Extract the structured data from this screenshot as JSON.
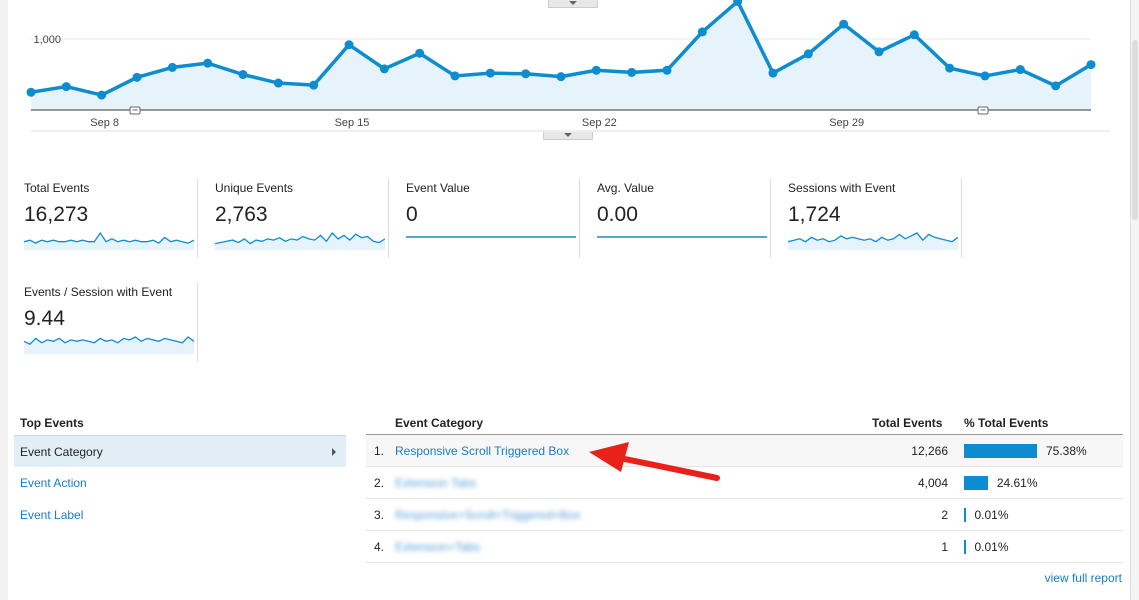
{
  "main_chart": {
    "y_tick_label": "1,000",
    "x_tick_labels": [
      "Sep 8",
      "Sep 15",
      "Sep 22",
      "Sep 29"
    ],
    "colors": {
      "line": "#0e8cd0",
      "fill": "#e6f3fa",
      "grid": "#e8e8e8"
    },
    "y_range": [
      0,
      1550
    ],
    "values": [
      250,
      330,
      210,
      460,
      600,
      660,
      500,
      380,
      350,
      920,
      580,
      800,
      480,
      520,
      510,
      470,
      560,
      530,
      560,
      1100,
      1530,
      520,
      790,
      1210,
      820,
      1060,
      590,
      480,
      570,
      340,
      640
    ],
    "annotation_markers": [
      "annotation-icon",
      "annotation-icon"
    ]
  },
  "metrics": [
    {
      "label": "Total Events",
      "value": "16,273",
      "spark": [
        3,
        4,
        2,
        4,
        3,
        4,
        3,
        3,
        4,
        3,
        4,
        3,
        3,
        9,
        3,
        5,
        3,
        4,
        3,
        4,
        3,
        3,
        4,
        2,
        6,
        3,
        4,
        3,
        2,
        4
      ],
      "flat": false
    },
    {
      "label": "Unique Events",
      "value": "2,763",
      "spark": [
        2,
        3,
        4,
        5,
        3,
        6,
        2,
        5,
        4,
        6,
        5,
        7,
        4,
        6,
        5,
        8,
        6,
        5,
        9,
        4,
        11,
        6,
        9,
        5,
        10,
        7,
        8,
        4,
        3,
        6
      ],
      "flat": false
    },
    {
      "label": "Event Value",
      "value": "0",
      "spark": [],
      "flat": true
    },
    {
      "label": "Avg. Value",
      "value": "0.00",
      "spark": [],
      "flat": true
    },
    {
      "label": "Sessions with Event",
      "value": "1,724",
      "spark": [
        3,
        4,
        5,
        3,
        6,
        4,
        5,
        3,
        4,
        7,
        5,
        6,
        5,
        4,
        5,
        3,
        6,
        4,
        5,
        8,
        5,
        7,
        9,
        4,
        8,
        6,
        5,
        4,
        3,
        6
      ],
      "flat": false
    },
    {
      "label": "Events / Session with Event",
      "value": "9.44",
      "spark": [
        6,
        4,
        8,
        5,
        7,
        6,
        8,
        5,
        7,
        6,
        7,
        6,
        5,
        8,
        6,
        7,
        5,
        8,
        7,
        9,
        6,
        8,
        7,
        6,
        8,
        7,
        6,
        5,
        9,
        6
      ],
      "flat": false
    }
  ],
  "top_events": {
    "title": "Top Events",
    "items": [
      {
        "label": "Event Category",
        "selected": true
      },
      {
        "label": "Event Action",
        "selected": false
      },
      {
        "label": "Event Label",
        "selected": false
      }
    ]
  },
  "table": {
    "headers": {
      "category": "Event Category",
      "total": "Total Events",
      "pct": "% Total Events"
    },
    "rows": [
      {
        "num": "1.",
        "name": "Responsive Scroll Triggered Box",
        "total": "12,266",
        "pct": "75.38%",
        "share": 75.38,
        "blurred": false
      },
      {
        "num": "2.",
        "name": "Extension Tabs",
        "total": "4,004",
        "pct": "24.61%",
        "share": 24.61,
        "blurred": true
      },
      {
        "num": "3.",
        "name": "Responsive+Scroll+Triggered+Box",
        "total": "2",
        "pct": "0.01%",
        "share": 0.01,
        "blurred": true
      },
      {
        "num": "4.",
        "name": "Extension+Tabs",
        "total": "1",
        "pct": "0.01%",
        "share": 0.01,
        "blurred": true
      }
    ],
    "view_full_report": "view full report"
  },
  "annotation_arrow_color": "#e8211b"
}
